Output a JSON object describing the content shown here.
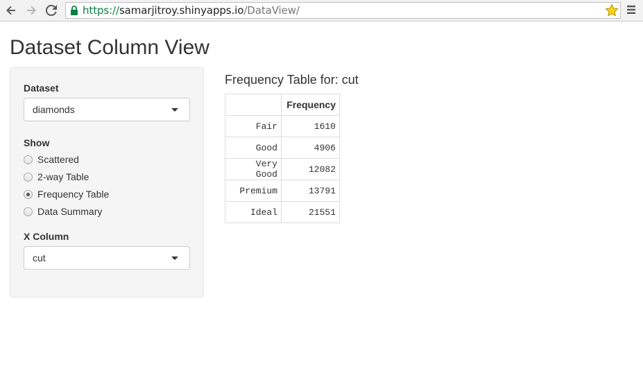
{
  "browser": {
    "url_scheme": "https://",
    "url_host": "samarjitroy.shinyapps.io",
    "url_path": "/DataView/",
    "icons": [
      "back-icon",
      "forward-icon",
      "reload-icon",
      "lock-icon",
      "star-icon",
      "menu-icon"
    ]
  },
  "page": {
    "title": "Dataset Column View"
  },
  "sidebar": {
    "dataset_label": "Dataset",
    "dataset_value": "diamonds",
    "show_label": "Show",
    "show_options": [
      {
        "label": "Scattered",
        "checked": false
      },
      {
        "label": "2-way Table",
        "checked": false
      },
      {
        "label": "Frequency Table",
        "checked": true
      },
      {
        "label": "Data Summary",
        "checked": false
      }
    ],
    "xcol_label": "X Column",
    "xcol_value": "cut"
  },
  "output": {
    "title": "Frequency Table for: cut",
    "table": {
      "headers": [
        "",
        "Frequency"
      ],
      "rows": [
        {
          "name": "Fair",
          "value": "1610"
        },
        {
          "name": "Good",
          "value": "4906"
        },
        {
          "name": "Very Good",
          "value": "12082"
        },
        {
          "name": "Premium",
          "value": "13791"
        },
        {
          "name": "Ideal",
          "value": "21551"
        }
      ]
    }
  },
  "colors": {
    "secure_green": "#0b8043",
    "star_yellow": "#f5d21a",
    "well_bg": "#f5f5f5"
  }
}
